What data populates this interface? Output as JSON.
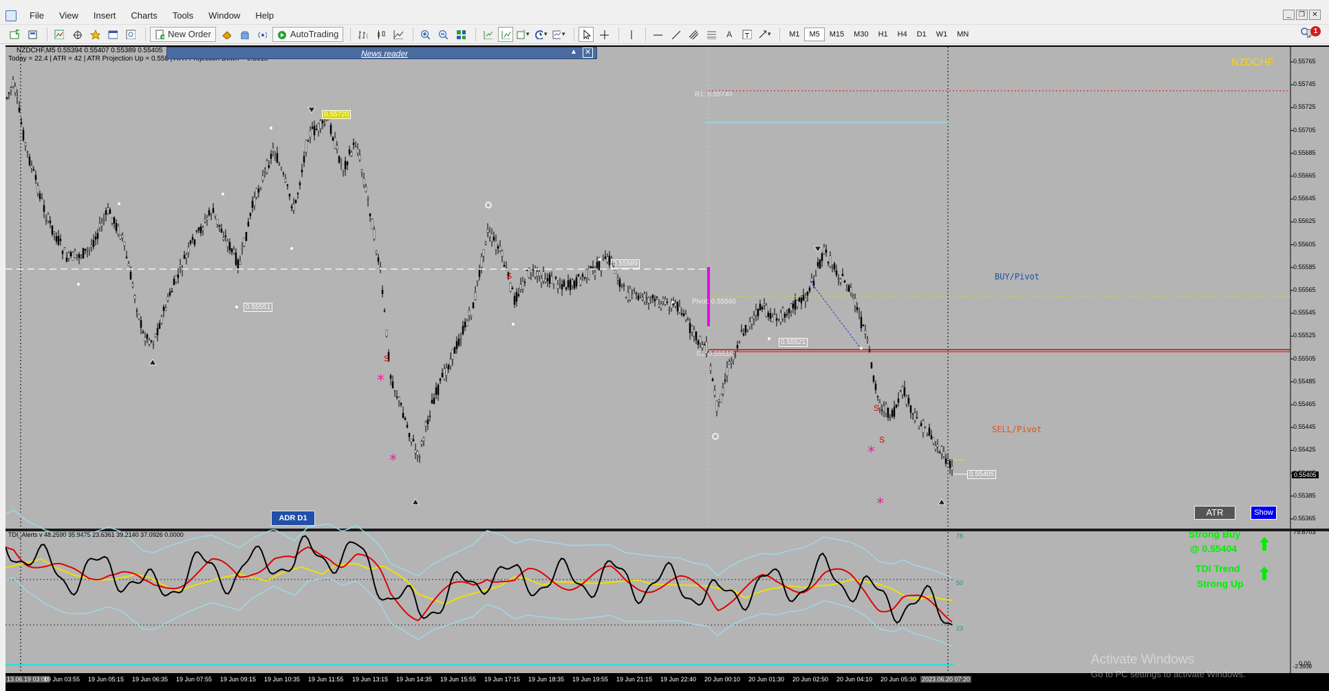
{
  "menu": [
    "File",
    "View",
    "Insert",
    "Charts",
    "Tools",
    "Window",
    "Help"
  ],
  "toolbar": {
    "new_order": "New Order",
    "auto_trading": "AutoTrading",
    "timeframes": [
      "M1",
      "M5",
      "M15",
      "M30",
      "H1",
      "H4",
      "D1",
      "W1",
      "MN"
    ],
    "active_timeframe": "M5",
    "notification_count": "1"
  },
  "chart": {
    "header": "NZDCHF,M5  0.55394 0.55407 0.55389 0.55405",
    "info": "Today = 22.4   |   ATR = 42   |   ATR Projection Up = 0.558   |   ATR Projection Down = 0.5518",
    "symbol_watermark": "NZDCHF",
    "news_reader": "News reader",
    "adr_button": "ADR D1",
    "atr_button": "ATR",
    "show_button": "Show",
    "buy_pivot": "BUY/Pivot",
    "sell_pivot": "SELL/Pivot",
    "r1_label": "R1: 0.55740",
    "pivot_label": "Pivot: 0.55560",
    "s_label": "S1: 0.55510",
    "price_tags": [
      "0.55720",
      "0.55589",
      "0.55551",
      "0.55521",
      "0.55405"
    ],
    "current_price": "0.55405",
    "signal_letter": "S",
    "price_axis": [
      "0.55765",
      "0.55745",
      "0.55725",
      "0.55705",
      "0.55685",
      "0.55665",
      "0.55645",
      "0.55625",
      "0.55605",
      "0.55585",
      "0.55565",
      "0.55545",
      "0.55525",
      "0.55505",
      "0.55485",
      "0.55465",
      "0.55445",
      "0.55425",
      "0.55405",
      "0.55385",
      "0.55365"
    ]
  },
  "indicator": {
    "header": "TDI_Alerts v 48.2590 35.9475 23.6361 39.2140 37.0926 0.0000",
    "levels": [
      "78",
      "50",
      "23"
    ],
    "axis_top": "79.6703",
    "axis_bottom": "0.00",
    "axis_bottom2": "-2.3938",
    "strong_buy": "Strong Buy",
    "strong_buy_price": "@ 0.55404",
    "tdi_trend": "TDI Trend",
    "strong_up": "Strong Up"
  },
  "time_axis": [
    "13.06.19 03:00",
    "19 Jun 03:55",
    "19 Jun 05:15",
    "19 Jun 06:35",
    "19 Jun 07:55",
    "19 Jun 09:15",
    "19 Jun 10:35",
    "19 Jun 11:55",
    "19 Jun 13:15",
    "19 Jun 14:35",
    "19 Jun 15:55",
    "19 Jun 17:15",
    "19 Jun 18:35",
    "19 Jun 19:55",
    "19 Jun 21:15",
    "19 Jun 22:40",
    "20 Jun 00:10",
    "20 Jun 01:30",
    "20 Jun 02:50",
    "20 Jun 04:10",
    "20 Jun 05:30",
    "2023.06.20 07:20"
  ],
  "watermark": {
    "line1": "Activate Windows",
    "line2": "Go to PC settings to activate Windows."
  },
  "colors": {
    "chart_bg": "#b4b4b4",
    "candle": "#000000",
    "buy_text": "#1f4fa8",
    "sell_text": "#e0501a",
    "pivot_line": "#e00000",
    "magenta": "#ee00ee",
    "signal_green": "#00ee00",
    "symbol_gold": "#ffd700"
  }
}
